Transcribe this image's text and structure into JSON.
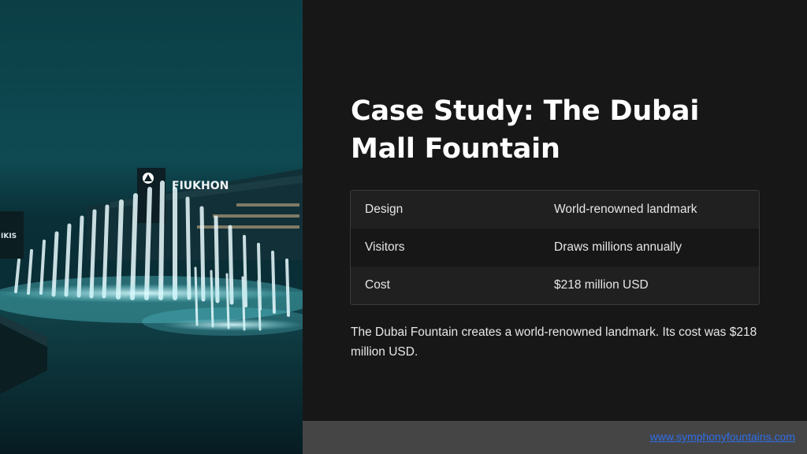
{
  "photo": {
    "sign_text": "FIUKHON",
    "side_sign_text": "IKIS"
  },
  "slide": {
    "title": "Case Study: The Dubai Mall Fountain",
    "table": [
      {
        "label": "Design",
        "value": "World-renowned landmark"
      },
      {
        "label": "Visitors",
        "value": "Draws millions annually"
      },
      {
        "label": "Cost",
        "value": "$218 million USD"
      }
    ],
    "summary": "The Dubai Fountain creates a world-renowned landmark. Its cost was $218 million USD."
  },
  "footer": {
    "link_text": "www.symphonyfountains.com"
  },
  "colors": {
    "background": "#171717",
    "link": "#2f6ee8",
    "footer_bar": "#454545"
  }
}
